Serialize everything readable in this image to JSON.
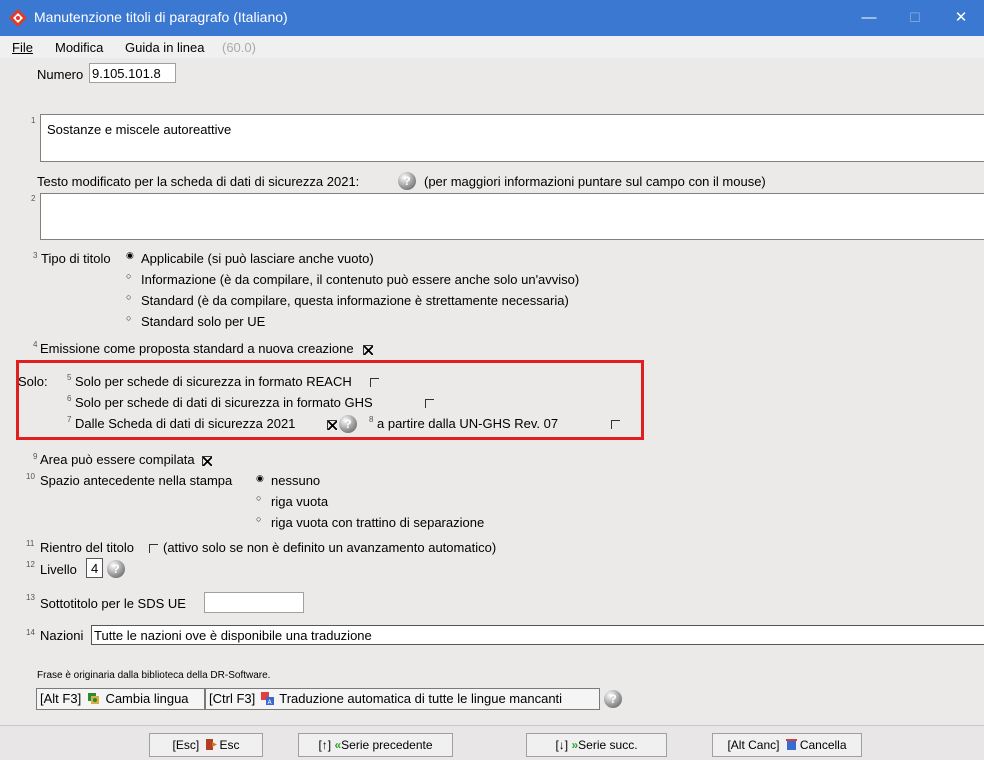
{
  "window": {
    "title": "Manutenzione titoli di paragrafo (Italiano)",
    "minimize": "—",
    "maximize": "☐",
    "close": "✕"
  },
  "menu": {
    "file": "File",
    "modifica": "Modifica",
    "guida": "Guida in linea",
    "version": "(60.0)"
  },
  "numero": {
    "label": "Numero",
    "value": "9.105.101.8"
  },
  "field1": {
    "num": "1",
    "value": "Sostanze e miscele autoreattive"
  },
  "testo_mod": {
    "label": "Testo modificato per la scheda di dati di sicurezza 2021:",
    "hint": "(per maggiori informazioni puntare sul campo con il mouse)",
    "num": "2",
    "value": ""
  },
  "tipo": {
    "num": "3",
    "label": "Tipo di titolo",
    "options": [
      "Applicabile (si può lasciare anche vuoto)",
      "Informazione (è da compilare, il contenuto può essere anche solo un'avviso)",
      "Standard (è da compilare, questa informazione è strettamente necessaria)",
      "Standard solo per UE"
    ],
    "selected": 0
  },
  "emissione": {
    "num": "4",
    "label": "Emissione come proposta standard a nuova creazione",
    "checked": true
  },
  "solo": {
    "label": "Solo:",
    "reach": {
      "num": "5",
      "label": "Solo per schede di sicurezza in formato REACH",
      "checked": false
    },
    "ghs": {
      "num": "6",
      "label": "Solo per schede di dati di sicurezza in formato GHS",
      "checked": false
    },
    "sds2021": {
      "num": "7",
      "label": "Dalle Scheda di dati di sicurezza 2021",
      "checked": true
    },
    "unghs": {
      "num": "8",
      "label": "a partire dalla UN-GHS Rev. 07",
      "checked": false
    }
  },
  "area": {
    "num": "9",
    "label": "Area può essere compilata",
    "checked": true
  },
  "spazio": {
    "num": "10",
    "label": "Spazio antecedente nella stampa",
    "options": [
      "nessuno",
      "riga vuota",
      "riga vuota con trattino di separazione"
    ],
    "selected": 0
  },
  "rientro": {
    "num": "11",
    "label": "Rientro del titolo",
    "hint": "(attivo solo se non è definito un avanzamento automatico)",
    "checked": false
  },
  "livello": {
    "num": "12",
    "label": "Livello",
    "value": "4"
  },
  "sottotitolo": {
    "num": "13",
    "label": "Sottotitolo per le SDS UE",
    "value": ""
  },
  "nazioni": {
    "num": "14",
    "label": "Nazioni",
    "value": "Tutte le nazioni ove è disponibile una traduzione"
  },
  "origin_note": "Frase è originaria dalla biblioteca della DR-Software.",
  "tools": {
    "cambia_key": "[Alt F3]",
    "cambia_label": "Cambia lingua",
    "trad_key": "[Ctrl F3]",
    "trad_label": "Traduzione automatica di tutte le lingue mancanti"
  },
  "buttons": {
    "esc_key": "[Esc]",
    "esc_label": "Esc",
    "prev_key": "[↑]",
    "prev_label": "Serie precedente",
    "next_key": "[↓]",
    "next_label": "Serie succ.",
    "del_key": "[Alt Canc]",
    "del_label": "Cancella"
  },
  "colors": {
    "titlebar": "#3a78d2",
    "highlight": "#e02020",
    "background": "#ece9e9"
  }
}
